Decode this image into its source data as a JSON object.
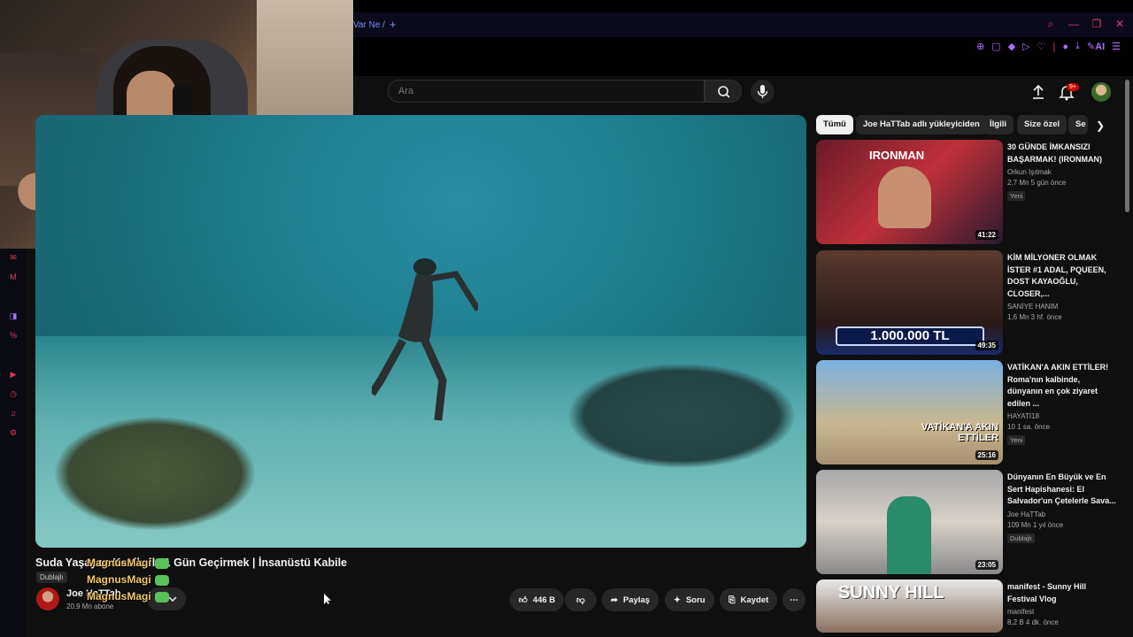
{
  "browser": {
    "tab_label": "Var Ne /",
    "tab_plus": "+",
    "ext_ai_label": "AI"
  },
  "header": {
    "search_placeholder": "Ara",
    "notification_count": "9+"
  },
  "video": {
    "title": "Suda Yaşayan Kabile ile 1 Gün Geçirmek | İnsanüstü Kabile",
    "dub_tag": "Dublajlı",
    "channel_name": "Joe HaTTab",
    "channel_subs": "20,9 Mn abone",
    "likes": "446 B",
    "share_label": "Paylaş",
    "ask_label": "Soru",
    "save_label": "Kaydet"
  },
  "chat_overlay": [
    "MagnusMagi",
    "MagnusMagi",
    "MagnusMagi"
  ],
  "chips": [
    {
      "label": "Tümü",
      "active": true
    },
    {
      "label": "Joe HaTTab adlı yükleyiciden",
      "active": false
    },
    {
      "label": "İlgili",
      "active": false
    },
    {
      "label": "Size özel",
      "active": false
    },
    {
      "label": "Se",
      "active": false
    }
  ],
  "recommendations": [
    {
      "title": "30 GÜNDE İMKANSIZI BAŞARMAK! (IRONMAN)",
      "channel": "Orkun Işıtmak",
      "meta": "2,7 Mn  5 gün önce",
      "badge": "Yeni",
      "duration": "41:22",
      "thumb_text": "IRONMAN"
    },
    {
      "title": "KİM MİLYONER OLMAK İSTER #1 ADAL, PQUEEN, DOST KAYAOĞLU, CLOSER,...",
      "channel": "SANİYE HANIM",
      "meta": "1,6 Mn  3 hf. önce",
      "badge": "",
      "duration": "49:35",
      "thumb_text": "1.000.000 TL"
    },
    {
      "title": "VATİKAN'A AKIN ETTİLER! Roma'nın kalbinde, dünyanın en çok ziyaret edilen ...",
      "channel": "HAYATİ18",
      "meta": "10  1 sa. önce",
      "badge": "Yeni",
      "duration": "25:16",
      "thumb_text": "VATİKAN'A AKIN ETTİLER"
    },
    {
      "title": "Dünyanın En Büyük ve En Sert Hapishanesi: El Salvador'un Çetelerle Sava...",
      "channel": "Joe HaTTab",
      "meta": "109 Mn  1 yıl önce",
      "badge": "Dublajlı",
      "duration": "23:05",
      "thumb_text": ""
    },
    {
      "title": "manifest - Sunny Hill Festival Vlog",
      "channel": "manifest",
      "meta": "8,2 B  4 dk. önce",
      "badge": "",
      "duration": "",
      "thumb_text": "SUNNY HILL"
    }
  ],
  "colors": {
    "accent": "#e23b5a",
    "brand_red": "#cc0000",
    "chip_bg": "#272727"
  }
}
